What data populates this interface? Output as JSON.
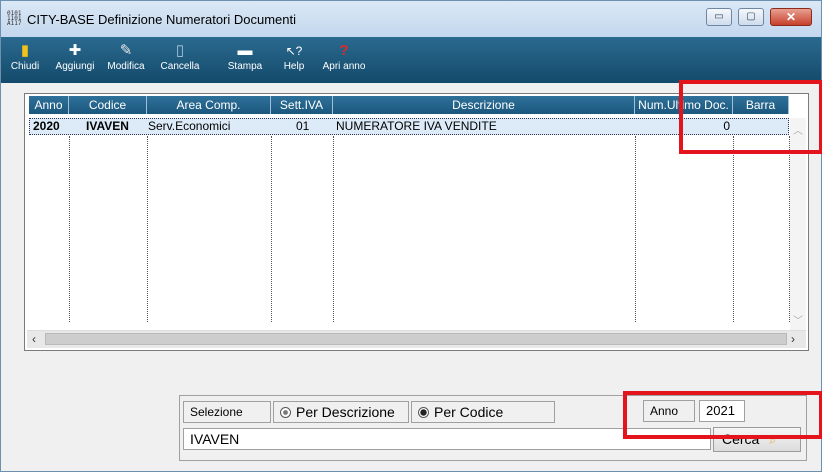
{
  "window": {
    "title": "CITY-BASE Definizione Numeratori Documenti",
    "app_icon_text": "0101 1101 A117",
    "controls": {
      "minimize": "▭",
      "maximize": "▢",
      "close": "✕"
    }
  },
  "toolbar": {
    "items": [
      {
        "label": "Chiudi",
        "icon": "door-exit-icon",
        "glyph": "▮",
        "color": "#f2c21a"
      },
      {
        "label": "Aggiungi",
        "icon": "plus-icon",
        "glyph": "✚",
        "color": "#ffffff"
      },
      {
        "label": "Modifica",
        "icon": "edit-icon",
        "glyph": "✎",
        "color": "#e6e6e6"
      },
      {
        "label": "Cancella",
        "icon": "trash-icon",
        "glyph": "🗑",
        "color": "#a9c7dd"
      },
      {
        "label": "Stampa",
        "icon": "printer-icon",
        "glyph": "🖶",
        "color": "#ffffff"
      },
      {
        "label": "Help",
        "icon": "help-cursor-icon",
        "glyph": "↖?",
        "color": "#ffffff"
      },
      {
        "label": "Apri anno",
        "icon": "calendar-open-icon",
        "glyph": "?",
        "color": "#e0282a"
      }
    ]
  },
  "grid": {
    "columns": [
      "Anno",
      "Codice",
      "Area Comp.",
      "Sett.IVA",
      "Descrizione",
      "Num.Ultimo Doc.",
      "Barra"
    ],
    "rows": [
      {
        "anno": "2020",
        "codice": "IVAVEN",
        "area": "Serv.Economici",
        "sett": "01",
        "descrizione": "NUMERATORE IVA VENDITE",
        "num": "0",
        "barra": ""
      }
    ]
  },
  "filter": {
    "selezione_label": "Selezione",
    "options": [
      {
        "label": "Per Descrizione",
        "selected": false
      },
      {
        "label": "Per Codice",
        "selected": true
      }
    ],
    "anno_label": "Anno",
    "anno_value": "2021",
    "search_value": "IVAVEN",
    "search_button": "Cerca"
  },
  "colors": {
    "toolbar": "#1b577d",
    "highlight": "#e3141b",
    "selected_row": "#dcebf7"
  }
}
